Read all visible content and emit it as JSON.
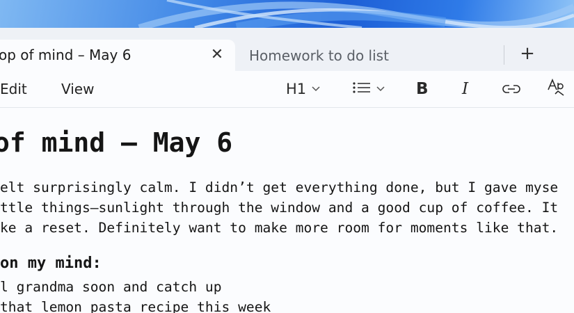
{
  "tabs": {
    "active": {
      "title": "op of mind – May 6",
      "close_glyph": "✕"
    },
    "inactive": {
      "title": "Homework to do list"
    },
    "new_tab_glyph": "+"
  },
  "menu": {
    "edit": "Edit",
    "view": "View"
  },
  "format_toolbar": {
    "heading": "H1",
    "bold": "B",
    "italic": "I",
    "icons": [
      "chevron-down-icon",
      "bulleted-list-icon",
      "link-icon",
      "spellcheck-icon"
    ]
  },
  "document": {
    "heading": "of mind – May 6",
    "paragraph": [
      "elt surprisingly calm. I didn’t get everything done, but I gave myse",
      "ttle things—sunlight through the window and a good cup of coffee. It",
      "ke a reset. Definitely want to make more room for moments like that."
    ],
    "subheading": "on my mind:",
    "list": [
      "l grandma soon and catch up",
      " that lemon pasta recipe this week"
    ]
  },
  "colors": {
    "accent": "#1d5fd6",
    "window_bg": "#fbfcfe",
    "tabbar_bg": "#eef1f6"
  }
}
